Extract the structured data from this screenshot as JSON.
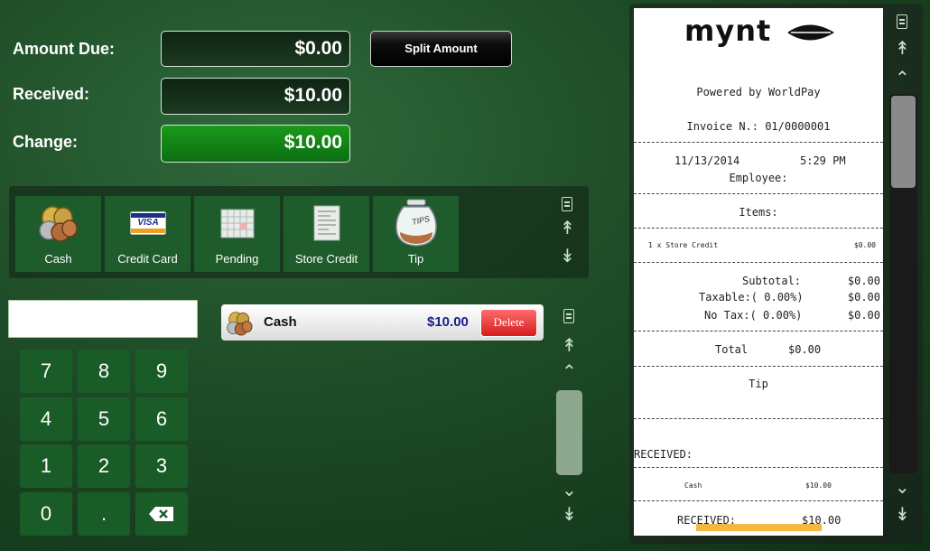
{
  "amounts": {
    "due_label": "Amount Due:",
    "due_value": "$0.00",
    "received_label": "Received:",
    "received_value": "$10.00",
    "change_label": "Change:",
    "change_value": "$10.00",
    "split_label": "Split Amount"
  },
  "methods": [
    {
      "label": "Cash",
      "icon": "coins-icon"
    },
    {
      "label": "Credit Card",
      "icon": "visa-card-icon",
      "card_text": "VISA"
    },
    {
      "label": "Pending",
      "icon": "calendar-icon"
    },
    {
      "label": "Store Credit",
      "icon": "document-icon"
    },
    {
      "label": "Tip",
      "icon": "tip-jar-icon",
      "jar_text": "TIPS"
    }
  ],
  "keypad": {
    "keys": [
      "7",
      "8",
      "9",
      "4",
      "5",
      "6",
      "1",
      "2",
      "3",
      "0",
      "."
    ],
    "backspace_icon": "backspace-icon"
  },
  "entry": {
    "value": ""
  },
  "tender": {
    "method": "Cash",
    "amount": "$10.00",
    "delete_label": "Delete"
  },
  "receipt": {
    "logo": "mynt",
    "powered": "Powered by WorldPay",
    "invoice": "Invoice N.: 01/0000001",
    "date": "11/13/2014",
    "time": "5:29 PM",
    "employee": "Employee:",
    "items_header": "Items:",
    "item_line": "1 x Store Credit",
    "item_amount": "$0.00",
    "subtotal_label": "Subtotal:",
    "subtotal_value": "$0.00",
    "taxable_label": "Taxable:( 0.00%)",
    "taxable_value": "$0.00",
    "notax_label": "No Tax:( 0.00%)",
    "notax_value": "$0.00",
    "total_label": "Total",
    "total_value": "$0.00",
    "tip_label": "Tip",
    "received_header": "RECEIVED:",
    "cash_label": "Cash",
    "cash_value": "$10.00",
    "received2_label": "RECEIVED:",
    "received2_value": "$10.00"
  },
  "colors": {
    "background": "#1f4d28",
    "change_box": "#129012",
    "method_tile": "#1f5c2c",
    "delete": "#e03030",
    "amount_text": "#1a1a8c",
    "receipt_highlight": "#f5b642"
  }
}
